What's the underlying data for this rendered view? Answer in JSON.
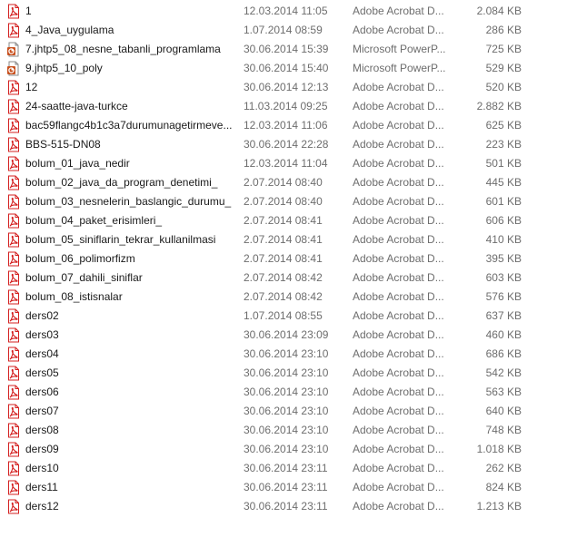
{
  "colors": {
    "pdf_red": "#d42020",
    "ppt_orange": "#c8501e",
    "text_primary": "#1a1a1a",
    "text_secondary": "#6d6d6d"
  },
  "files": [
    {
      "name": "1",
      "modified": "12.03.2014 11:05",
      "type": "Adobe Acrobat D...",
      "size": "2.084 KB",
      "icon": "pdf-file-icon"
    },
    {
      "name": "4_Java_uygulama",
      "modified": "1.07.2014 08:59",
      "type": "Adobe Acrobat D...",
      "size": "286 KB",
      "icon": "pdf-file-icon"
    },
    {
      "name": "7.jhtp5_08_nesne_tabanli_programlama",
      "modified": "30.06.2014 15:39",
      "type": "Microsoft PowerP...",
      "size": "725 KB",
      "icon": "powerpoint-file-icon"
    },
    {
      "name": "9.jhtp5_10_poly",
      "modified": "30.06.2014 15:40",
      "type": "Microsoft PowerP...",
      "size": "529 KB",
      "icon": "powerpoint-file-icon"
    },
    {
      "name": "12",
      "modified": "30.06.2014 12:13",
      "type": "Adobe Acrobat D...",
      "size": "520 KB",
      "icon": "pdf-file-icon"
    },
    {
      "name": "24-saatte-java-turkce",
      "modified": "11.03.2014 09:25",
      "type": "Adobe Acrobat D...",
      "size": "2.882 KB",
      "icon": "pdf-file-icon"
    },
    {
      "name": "bac59flangc4b1c3a7durumunagetirmeve...",
      "modified": "12.03.2014 11:06",
      "type": "Adobe Acrobat D...",
      "size": "625 KB",
      "icon": "pdf-file-icon"
    },
    {
      "name": "BBS-515-DN08",
      "modified": "30.06.2014 22:28",
      "type": "Adobe Acrobat D...",
      "size": "223 KB",
      "icon": "pdf-file-icon"
    },
    {
      "name": "bolum_01_java_nedir",
      "modified": "12.03.2014 11:04",
      "type": "Adobe Acrobat D...",
      "size": "501 KB",
      "icon": "pdf-file-icon"
    },
    {
      "name": "bolum_02_java_da_program_denetimi_",
      "modified": "2.07.2014 08:40",
      "type": "Adobe Acrobat D...",
      "size": "445 KB",
      "icon": "pdf-file-icon"
    },
    {
      "name": "bolum_03_nesnelerin_baslangic_durumu_",
      "modified": "2.07.2014 08:40",
      "type": "Adobe Acrobat D...",
      "size": "601 KB",
      "icon": "pdf-file-icon"
    },
    {
      "name": "bolum_04_paket_erisimleri_",
      "modified": "2.07.2014 08:41",
      "type": "Adobe Acrobat D...",
      "size": "606 KB",
      "icon": "pdf-file-icon"
    },
    {
      "name": "bolum_05_siniflarin_tekrar_kullanilmasi",
      "modified": "2.07.2014 08:41",
      "type": "Adobe Acrobat D...",
      "size": "410 KB",
      "icon": "pdf-file-icon"
    },
    {
      "name": "bolum_06_polimorfizm",
      "modified": "2.07.2014 08:41",
      "type": "Adobe Acrobat D...",
      "size": "395 KB",
      "icon": "pdf-file-icon"
    },
    {
      "name": "bolum_07_dahili_siniflar",
      "modified": "2.07.2014 08:42",
      "type": "Adobe Acrobat D...",
      "size": "603 KB",
      "icon": "pdf-file-icon"
    },
    {
      "name": "bolum_08_istisnalar",
      "modified": "2.07.2014 08:42",
      "type": "Adobe Acrobat D...",
      "size": "576 KB",
      "icon": "pdf-file-icon"
    },
    {
      "name": "ders02",
      "modified": "1.07.2014 08:55",
      "type": "Adobe Acrobat D...",
      "size": "637 KB",
      "icon": "pdf-file-icon"
    },
    {
      "name": "ders03",
      "modified": "30.06.2014 23:09",
      "type": "Adobe Acrobat D...",
      "size": "460 KB",
      "icon": "pdf-file-icon"
    },
    {
      "name": "ders04",
      "modified": "30.06.2014 23:10",
      "type": "Adobe Acrobat D...",
      "size": "686 KB",
      "icon": "pdf-file-icon"
    },
    {
      "name": "ders05",
      "modified": "30.06.2014 23:10",
      "type": "Adobe Acrobat D...",
      "size": "542 KB",
      "icon": "pdf-file-icon"
    },
    {
      "name": "ders06",
      "modified": "30.06.2014 23:10",
      "type": "Adobe Acrobat D...",
      "size": "563 KB",
      "icon": "pdf-file-icon"
    },
    {
      "name": "ders07",
      "modified": "30.06.2014 23:10",
      "type": "Adobe Acrobat D...",
      "size": "640 KB",
      "icon": "pdf-file-icon"
    },
    {
      "name": "ders08",
      "modified": "30.06.2014 23:10",
      "type": "Adobe Acrobat D...",
      "size": "748 KB",
      "icon": "pdf-file-icon"
    },
    {
      "name": "ders09",
      "modified": "30.06.2014 23:10",
      "type": "Adobe Acrobat D...",
      "size": "1.018 KB",
      "icon": "pdf-file-icon"
    },
    {
      "name": "ders10",
      "modified": "30.06.2014 23:11",
      "type": "Adobe Acrobat D...",
      "size": "262 KB",
      "icon": "pdf-file-icon"
    },
    {
      "name": "ders11",
      "modified": "30.06.2014 23:11",
      "type": "Adobe Acrobat D...",
      "size": "824 KB",
      "icon": "pdf-file-icon"
    },
    {
      "name": "ders12",
      "modified": "30.06.2014 23:11",
      "type": "Adobe Acrobat D...",
      "size": "1.213 KB",
      "icon": "pdf-file-icon"
    }
  ]
}
